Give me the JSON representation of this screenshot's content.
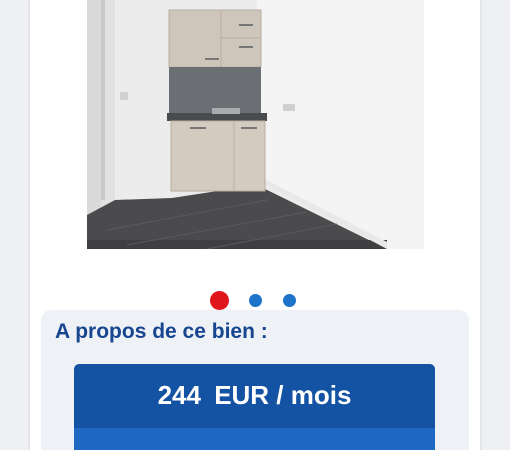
{
  "carousel": {
    "image_alt": "apartment-kitchenette-photo",
    "dot_count": 3,
    "active_index": 0,
    "active_color": "#e0161d",
    "inactive_color": "#1d73c8"
  },
  "about": {
    "title": "A propos de ce bien :"
  },
  "price": {
    "amount": "244",
    "currency_period": "EUR / mois"
  },
  "colors": {
    "title_blue": "#17458f",
    "price_bg": "#1452a3",
    "price_lower_bg": "#1f69c4"
  }
}
